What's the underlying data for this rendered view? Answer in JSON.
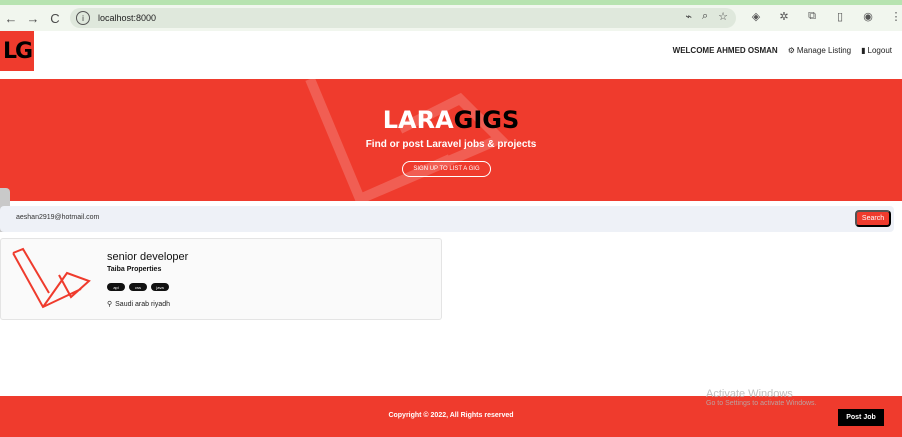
{
  "browser": {
    "url": "localhost:8000",
    "back_icon": "←",
    "forward_icon": "→",
    "reload_icon": "C"
  },
  "header": {
    "logo_text": "LG",
    "welcome": "WELCOME AHMED OSMAN",
    "manage_label": "Manage Listing",
    "logout_label": "Logout"
  },
  "hero": {
    "title_part1": "LARA",
    "title_part2": "GIGS",
    "subtitle": "Find or post Laravel jobs & projects",
    "button_label": "SIGN UP TO LIST A GIG"
  },
  "search": {
    "value": "aeshan2919@hotmail.com",
    "button_label": "Search"
  },
  "listings": [
    {
      "title": "senior developer",
      "company": "Taiba Properties",
      "tags": [
        "api",
        "css",
        "java"
      ],
      "location": "Saudi arab riyadh"
    }
  ],
  "footer": {
    "copyright": "Copyright © 2022, All Rights reserved",
    "post_button": "Post Job"
  },
  "watermark": {
    "title": "Activate Windows",
    "subtitle": "Go to Settings to activate Windows."
  },
  "colors": {
    "brand": "#ef3b2d",
    "dark": "#000000"
  }
}
